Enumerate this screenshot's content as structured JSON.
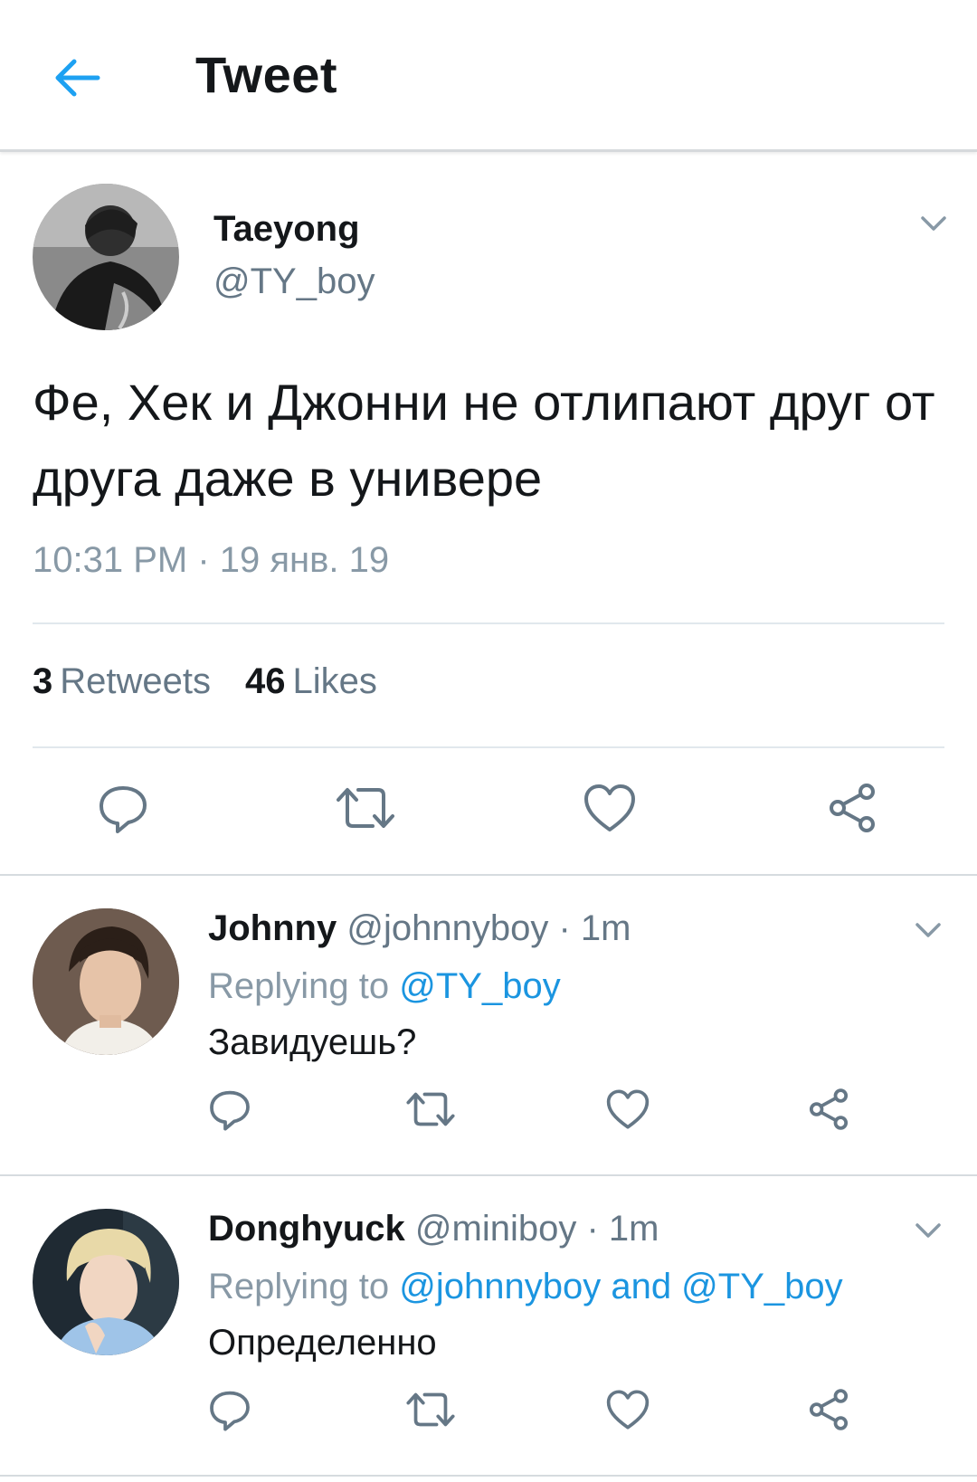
{
  "header": {
    "back_icon": "arrow-left-icon",
    "title": "Tweet",
    "accent_color": "#1da1f2"
  },
  "main_tweet": {
    "author_name": "Taeyong",
    "author_handle": "@TY_boy",
    "text": "Фе, Хек и Джонни не отлипают друг от друга даже в универе",
    "timestamp": "10:31 PM · 19 янв. 19",
    "retweets_count": "3",
    "retweets_label": "Retweets",
    "likes_count": "46",
    "likes_label": "Likes",
    "actions": [
      "reply-icon",
      "retweet-icon",
      "like-icon",
      "share-icon"
    ]
  },
  "replies": [
    {
      "author_name": "Johnny",
      "meta": "@johnnyboy · 1m",
      "replying_prefix": "Replying to",
      "replying_to": "@TY_boy",
      "text": "Завидуешь?"
    },
    {
      "author_name": "Donghyuck",
      "meta": "@miniboy · 1m",
      "replying_prefix": "Replying to",
      "replying_to": "@johnnyboy and @TY_boy",
      "text": "Определенно"
    }
  ],
  "colors": {
    "link": "#1b95e0",
    "secondary_text": "#657786",
    "icon_gray": "#657786"
  }
}
